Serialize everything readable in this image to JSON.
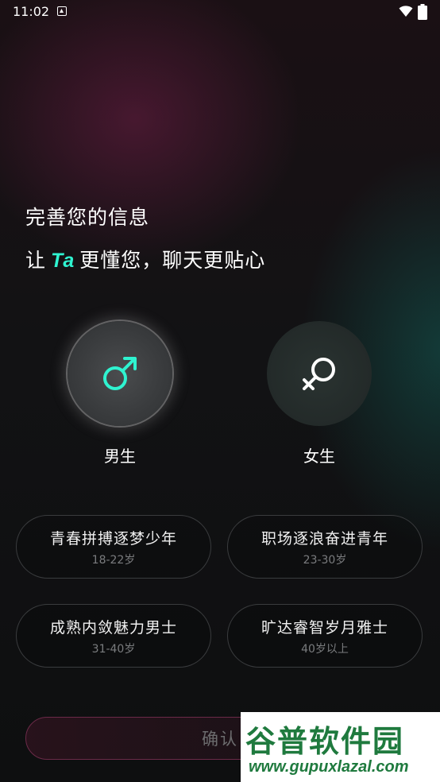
{
  "status_bar": {
    "time": "11:02"
  },
  "header": {
    "title": "完善您的信息",
    "subtitle_prefix": "让",
    "subtitle_highlight": "Ta",
    "subtitle_suffix": "更懂您，聊天更贴心"
  },
  "gender": {
    "male_label": "男生",
    "female_label": "女生",
    "selected": "male"
  },
  "age_options": [
    {
      "title": "青春拼搏逐梦少年",
      "range": "18-22岁"
    },
    {
      "title": "职场逐浪奋进青年",
      "range": "23-30岁"
    },
    {
      "title": "成熟内敛魅力男士",
      "range": "31-40岁"
    },
    {
      "title": "旷达睿智岁月雅士",
      "range": "40岁以上"
    }
  ],
  "confirm": {
    "label": "确认"
  },
  "watermark": {
    "brand": "谷普软件园",
    "url": "www.gupuxlazal.com"
  },
  "colors": {
    "accent": "#2ff3d0",
    "confirm_border": "#6b2a48"
  }
}
